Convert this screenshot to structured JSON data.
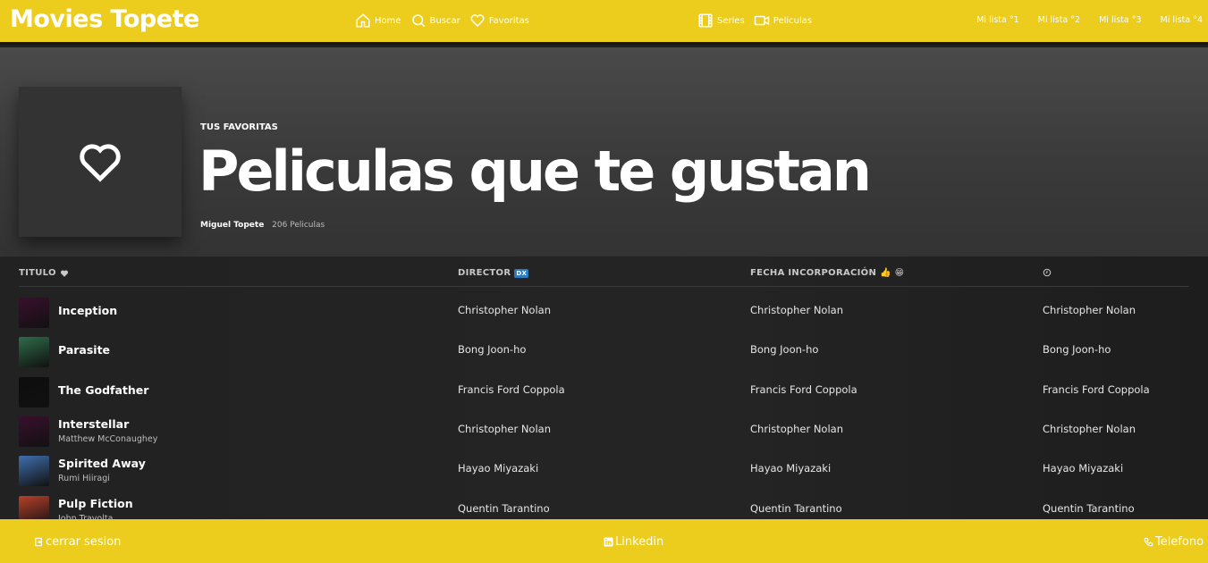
{
  "brand": "Movies Topete",
  "nav": {
    "home": "Home",
    "search": "Buscar",
    "favorites": "Favoritas",
    "series": "Series",
    "movies": "Peliculas",
    "lists": [
      "Mi lista °1",
      "Mi lista °2",
      "Mi lista °3",
      "Mi lista °4"
    ]
  },
  "hero": {
    "kicker": "TUS FAVORITAS",
    "title": "Peliculas que te gustan",
    "owner": "Miguel Topete",
    "count": "206 Peliculas"
  },
  "table": {
    "headers": {
      "title": "TITULO",
      "director": "DIRECTOR",
      "director_badge": "DX",
      "date": "FECHA INCORPORACIÓN",
      "date_emoji": "👍 😁",
      "time_icon": "clock-icon"
    },
    "rows": [
      {
        "title": "Inception",
        "subtitle": "",
        "director": "Christopher Nolan",
        "date": "Christopher Nolan",
        "time": "Christopher Nolan",
        "thumb_color": "#3a0f2e"
      },
      {
        "title": "Parasite",
        "subtitle": "",
        "director": "Bong Joon-ho",
        "date": "Bong Joon-ho",
        "time": "Bong Joon-ho",
        "thumb_color": "#2f6b4a"
      },
      {
        "title": "The Godfather",
        "subtitle": "",
        "director": "Francis Ford Coppola",
        "date": "Francis Ford Coppola",
        "time": "Francis Ford Coppola",
        "thumb_color": "#0d0d0d"
      },
      {
        "title": "Interstellar",
        "subtitle": "Matthew McConaughey",
        "director": "Christopher Nolan",
        "date": "Christopher Nolan",
        "time": "Christopher Nolan",
        "thumb_color": "#3a0f2e"
      },
      {
        "title": "Spirited Away",
        "subtitle": "Rumi Hiiragi",
        "director": "Hayao Miyazaki",
        "date": "Hayao Miyazaki",
        "time": "Hayao Miyazaki",
        "thumb_color": "#3f6fae"
      },
      {
        "title": "Pulp Fiction",
        "subtitle": "John Travolta",
        "director": "Quentin Tarantino",
        "date": "Quentin Tarantino",
        "time": "Quentin Tarantino",
        "thumb_color": "#b8402a"
      }
    ]
  },
  "footer": {
    "logout": "cerrar sesion",
    "linkedin": "Linkedin",
    "phone": "Telefono"
  },
  "colors": {
    "accent": "#eccc1c",
    "background": "#1e1e1e"
  }
}
